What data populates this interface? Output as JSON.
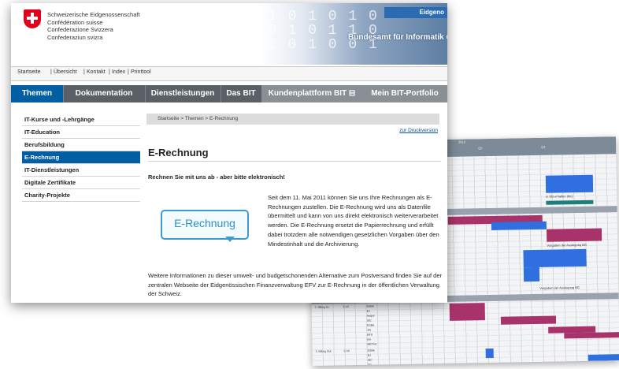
{
  "brand": {
    "lines": [
      "Schweizerische Eidgenossenschaft",
      "Confédération suisse",
      "Confederazione Svizzera",
      "Confederaziun svizra"
    ],
    "banner_label": "Eidgeno",
    "banner_title": "Bundesamt für Informatik u",
    "banner_digits": [
      "1 0 1 0 1 0",
      "0 1 0 1 1 0",
      "1 0 1 0 0 1"
    ]
  },
  "servicebar": {
    "items": [
      "Startseite",
      "Übersicht",
      "Kontakt",
      "Index",
      "Printtool"
    ]
  },
  "topnav": {
    "tabs": [
      "Themen",
      "Dokumentation",
      "Dienstleistungen",
      "Das BIT",
      "Kundenplattform BIT ⊟",
      "Mein BIT-Portfolio"
    ]
  },
  "sidenav": {
    "items": [
      "IT-Kurse und -Lehrgänge",
      "IT-Education",
      "Berufsbildung",
      "E-Rechnung",
      "IT-Dienstleistungen",
      "Digitale Zertifikate",
      "Charity-Projekte"
    ]
  },
  "breadcrumb": "Startseite > Themen > E-Rechnung",
  "print_link": "zur Druckversion",
  "title": "E-Rechnung",
  "lead": "Rechnen Sie mit uns ab - aber bitte elektronisch!",
  "logo_text": "E-Rechnung",
  "body1": "Seit dem 11. Mai 2011 können Sie uns Ihre Rechnungen als E-Rechnungen zustellen. Die E-Rechnung wird uns als Datenfile übermittelt und kann von uns direkt elektronisch weiterverarbeitet werden. Die E-Rechnung ersetzt die Papierrechnung und erfüllt dabei trotzdem alle notwendigen gesetzlichen Vorgaben über den Mindestinhalt und die Archivierung.",
  "body2": "Weitere Informationen zu dieser umwelt- und budgetschonenden Alternative zum Postversand finden Sie auf der zentralen Webseite der Eidgenössischen Finanzverwaltung EFV zur E-Rechnung in der öffentlichen Verwaltung der Schweiz.",
  "gantt": {
    "header_labels": [
      "2013",
      "Q1",
      "Q2",
      "Q3",
      "Q4"
    ],
    "notes": [
      "in DB erhalten (tbc)",
      "Vorgaben der Auslegung BG",
      "Vorgaben der Auslegung BG"
    ],
    "colors": {
      "magenta": "#a8336a",
      "blue": "#2f6fe0",
      "header": "#7d8a97"
    },
    "row_labels": [
      "3. Billing Ex",
      "0.XX",
      "ESBK",
      "BJ",
      "fedpol",
      "ISC",
      "ESBK",
      "SR",
      "BFS",
      "BA",
      "METAS",
      "3. Billing Out",
      "0.XX",
      "ESBK",
      "BJ",
      "ISC",
      "SR"
    ]
  }
}
